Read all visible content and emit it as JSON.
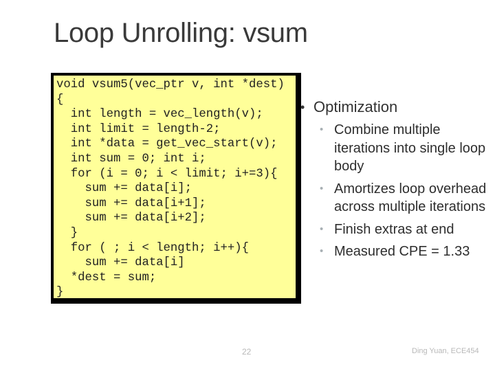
{
  "slide": {
    "title": "Loop Unrolling: vsum",
    "code_lines": [
      "void vsum5(vec_ptr v, int *dest)",
      "{",
      "  int length = vec_length(v);",
      "  int limit = length-2;",
      "  int *data = get_vec_start(v);",
      "  int sum = 0; int i;",
      "  for (i = 0; i < limit; i+=3){",
      "    sum += data[i];",
      "    sum += data[i+1];",
      "    sum += data[i+2];",
      "  }",
      "  for ( ; i < length; i++){",
      "    sum += data[i]",
      "  *dest = sum;",
      "}"
    ],
    "bullets": {
      "heading": "Optimization",
      "items": [
        "Combine multiple iterations into single loop body",
        "Amortizes loop overhead across multiple iterations",
        "Finish extras at end",
        "Measured CPE = 1.33"
      ]
    },
    "page_number": "22",
    "footer": "Ding Yuan, ECE454"
  },
  "colors": {
    "code_background": "#ffff99",
    "code_border": "#000000",
    "title_text": "#3a3a3a",
    "sub_bullet": "#a8b0b4"
  }
}
